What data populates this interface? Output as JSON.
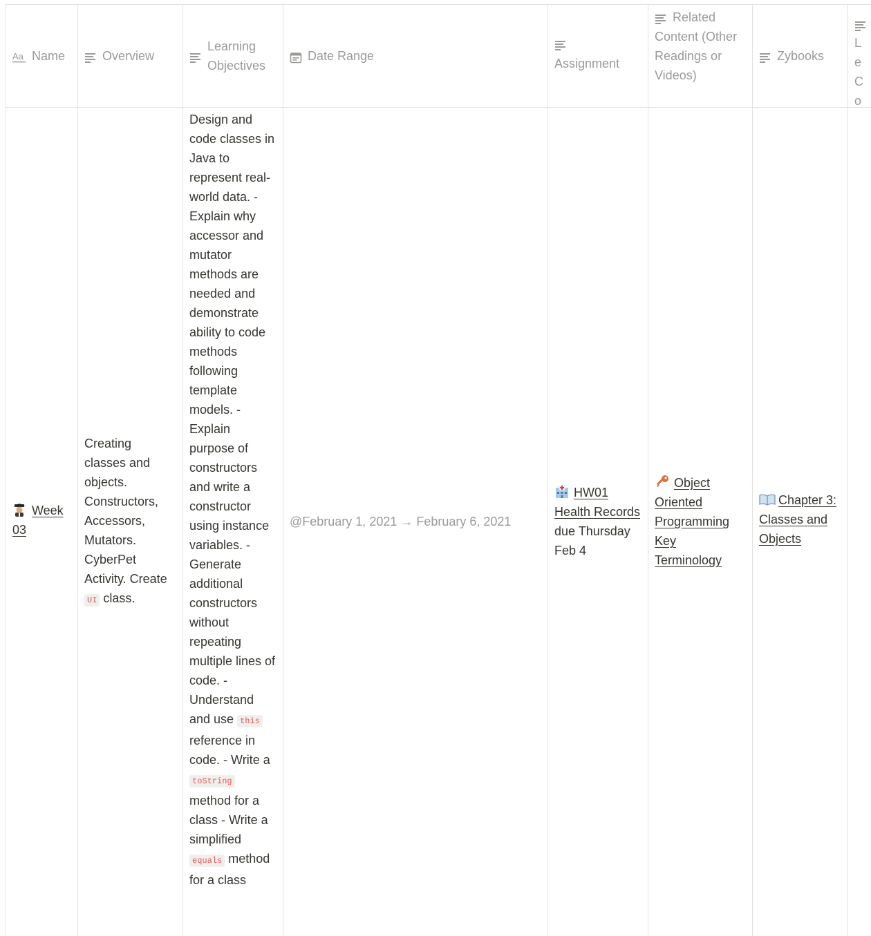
{
  "headers": {
    "name": "Name",
    "overview": "Overview",
    "learning_objectives": "Learning Objectives",
    "date_range": "Date Range",
    "assignment": "Assignment",
    "related_content": "Related Content (Other Readings or Videos)",
    "zybooks": "Zybooks",
    "next_col_partial": "Le Co Ex"
  },
  "row": {
    "name": "Week 03",
    "name_icon": "student-emoji",
    "overview": {
      "part1": "Creating classes and objects. Constructors, Accessors, Mutators. CyberPet Activity. Create",
      "code1": "UI",
      "part2": "class."
    },
    "learning_objectives": {
      "part1": "Design and code classes in Java to represent real-world data. - Explain why accessor and mutator methods are needed and demonstrate ability to code methods following template models. - Explain purpose of constructors and write a constructor using instance variables. - Generate additional constructors without repeating multiple lines of code. - Understand and use",
      "code1": "this",
      "part2": "reference in code. - Write a",
      "code2": "toString",
      "part3": "method for a class - Write a simplified",
      "code3": "equals",
      "part4": "method for a class"
    },
    "date_range": "@February 1, 2021 → February 6, 2021",
    "assignment": {
      "icon": "hospital-emoji",
      "link": "HW01 Health Records",
      "suffix": "due Thursday Feb 4"
    },
    "related_content": {
      "icon": "key-emoji",
      "link": "Object Oriented Programming Key Terminology"
    },
    "zybooks": {
      "icon": "book-emoji",
      "link": "Chapter 3: Classes and Objects"
    }
  },
  "colors": {
    "border": "#e3e2e0",
    "header_text": "#9b9a97",
    "body_text": "#37352f",
    "code_text": "#eb5757",
    "code_bg": "#f0efec"
  }
}
